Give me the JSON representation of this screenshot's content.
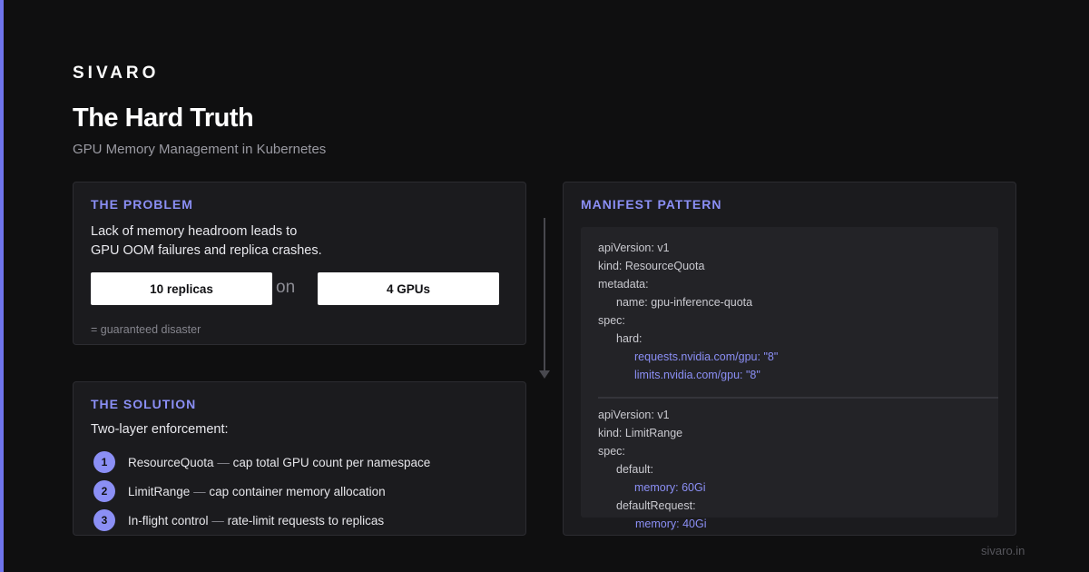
{
  "brand": "SIVARO",
  "title": "The Hard Truth",
  "subtitle": "GPU Memory Management in Kubernetes",
  "accent_color": "#6f74ec",
  "problem": {
    "heading": "THE PROBLEM",
    "line1": "Lack of memory headroom leads to",
    "line2": "GPU OOM failures and replica crashes.",
    "pill_a": "10 replicas",
    "connector_word": "on",
    "pill_b": "4 GPUs",
    "footnote": "= guaranteed disaster"
  },
  "solution": {
    "heading": "THE SOLUTION",
    "lead": "Two-layer enforcement:",
    "steps": [
      {
        "num": "1",
        "name": "ResourceQuota",
        "sep": "—",
        "desc": "cap total GPU count per namespace"
      },
      {
        "num": "2",
        "name": "LimitRange",
        "sep": "—",
        "desc": "cap container memory allocation"
      },
      {
        "num": "3",
        "name": "In-flight control",
        "sep": "—",
        "desc": "rate-limit requests to replicas"
      }
    ]
  },
  "manifest": {
    "heading": "MANIFEST PATTERN",
    "quota_lines": [
      "apiVersion: v1",
      "kind: ResourceQuota",
      "metadata:",
      "name: gpu-inference-quota",
      "spec:",
      "hard:",
      "requests.nvidia.com/gpu: \"8\"",
      "limits.nvidia.com/gpu: \"8\""
    ],
    "limit_lines": [
      "apiVersion: v1",
      "kind: LimitRange",
      "spec:",
      "default:",
      "memory: 60Gi",
      "defaultRequest:",
      "memory: 40Gi"
    ]
  },
  "footer_domain": "sivaro.in"
}
